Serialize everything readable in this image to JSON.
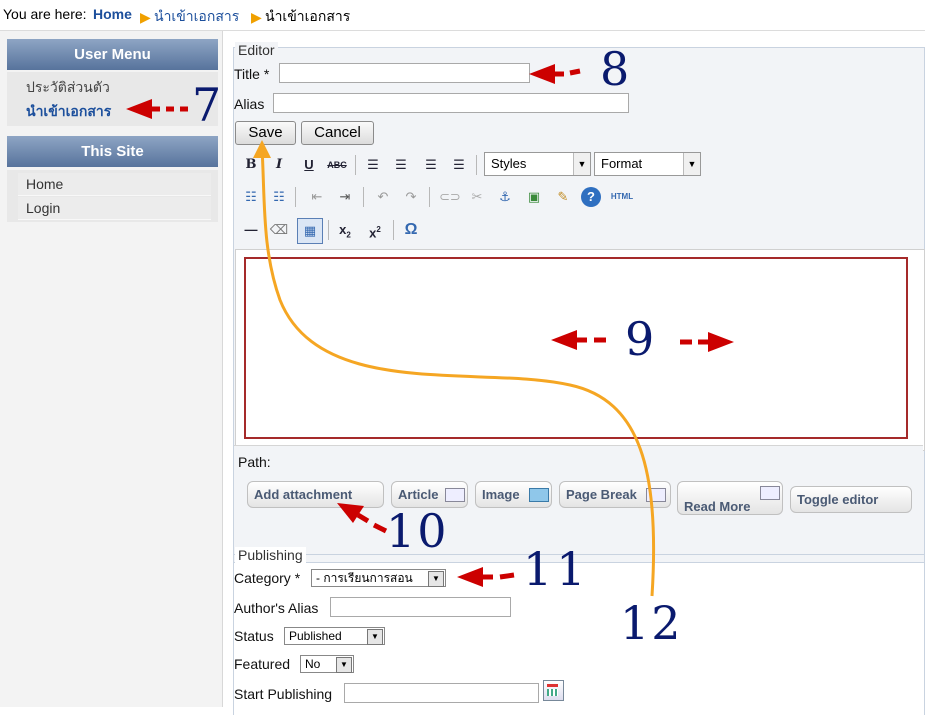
{
  "breadcrumb": {
    "prefix": "You are here:",
    "home": "Home",
    "item1": "นำเข้าเอกสาร",
    "item2": "นำเข้าเอกสาร"
  },
  "sidebar": {
    "user_menu_title": "User Menu",
    "user_menu_items": [
      {
        "label": "ประวัติส่วนตัว"
      },
      {
        "label": "นำเข้าเอกสาร"
      }
    ],
    "site_title": "This Site",
    "site_items": [
      {
        "label": "Home"
      },
      {
        "label": "Login"
      }
    ]
  },
  "editor": {
    "legend": "Editor",
    "title_label": "Title *",
    "title_value": "",
    "alias_label": "Alias",
    "alias_value": "",
    "save_label": "Save",
    "cancel_label": "Cancel",
    "styles_label": "Styles",
    "format_label": "Format",
    "path_label": "Path:",
    "buttons": {
      "add_attachment": "Add attachment",
      "article": "Article",
      "image": "Image",
      "page_break": "Page Break",
      "read_more": "Read More",
      "toggle_editor": "Toggle editor"
    }
  },
  "publishing": {
    "legend": "Publishing",
    "category_label": "Category *",
    "category_value": "- การเรียนการสอน",
    "authors_alias_label": "Author's Alias",
    "status_label": "Status",
    "status_value": "Published",
    "featured_label": "Featured",
    "featured_value": "No",
    "start_publishing_label": "Start Publishing"
  },
  "annotations": {
    "n7": "7",
    "n8": "8",
    "n9": "9",
    "n10": "10",
    "n11": "11",
    "n12": "12"
  },
  "colors": {
    "annotation_arrow": "#cc0000",
    "annotation_number": "#0a1a6e",
    "curve": "#f5a623",
    "editor_border": "#8b1a1a",
    "menu_header": "#6f88ad"
  }
}
